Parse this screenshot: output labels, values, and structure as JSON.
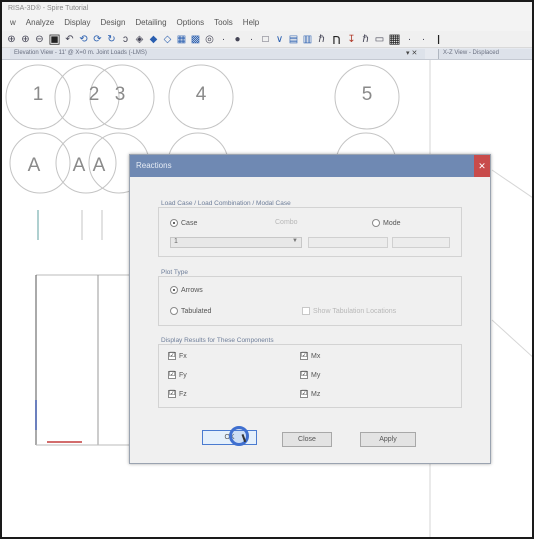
{
  "app": {
    "title": "RISA-3D® - Spire Tutorial"
  },
  "menu": [
    "w",
    "Analyze",
    "Display",
    "Design",
    "Detailing",
    "Options",
    "Tools",
    "Help"
  ],
  "tabs": {
    "left_title": "Elevation View - 11' @ X=0 m. Joint Loads (-LMS)",
    "left_close": "▾ ✕",
    "right_title": "X-Z View - Displaced"
  },
  "grid": {
    "numbers": [
      "1",
      "2",
      "3",
      "4",
      "5"
    ],
    "letters": [
      "A",
      "A",
      "A"
    ]
  },
  "dialog": {
    "title": "Reactions",
    "close": "✕",
    "load_group_label": "Load Case / Load Combination / Modal Case",
    "case_label": "Case",
    "combo_label": "Combo",
    "mode_label": "Mode",
    "case_value": "1",
    "plot_type_label": "Plot Type",
    "arrows_label": "Arrows",
    "tabulated_label": "Tabulated",
    "show_locations_label": "Show Tabulation Locations",
    "display_label": "Display Results for These Components",
    "components_left": [
      "Fx",
      "Fy",
      "Fz"
    ],
    "components_right": [
      "Mx",
      "My",
      "Mz"
    ],
    "check_mark": "☑",
    "ok_label": "OK",
    "close_label": "Close",
    "apply_label": "Apply"
  },
  "colors": {
    "dialog_title": "#6f89b3",
    "close_button": "#c84b4b",
    "group_label": "#6d7d99"
  }
}
